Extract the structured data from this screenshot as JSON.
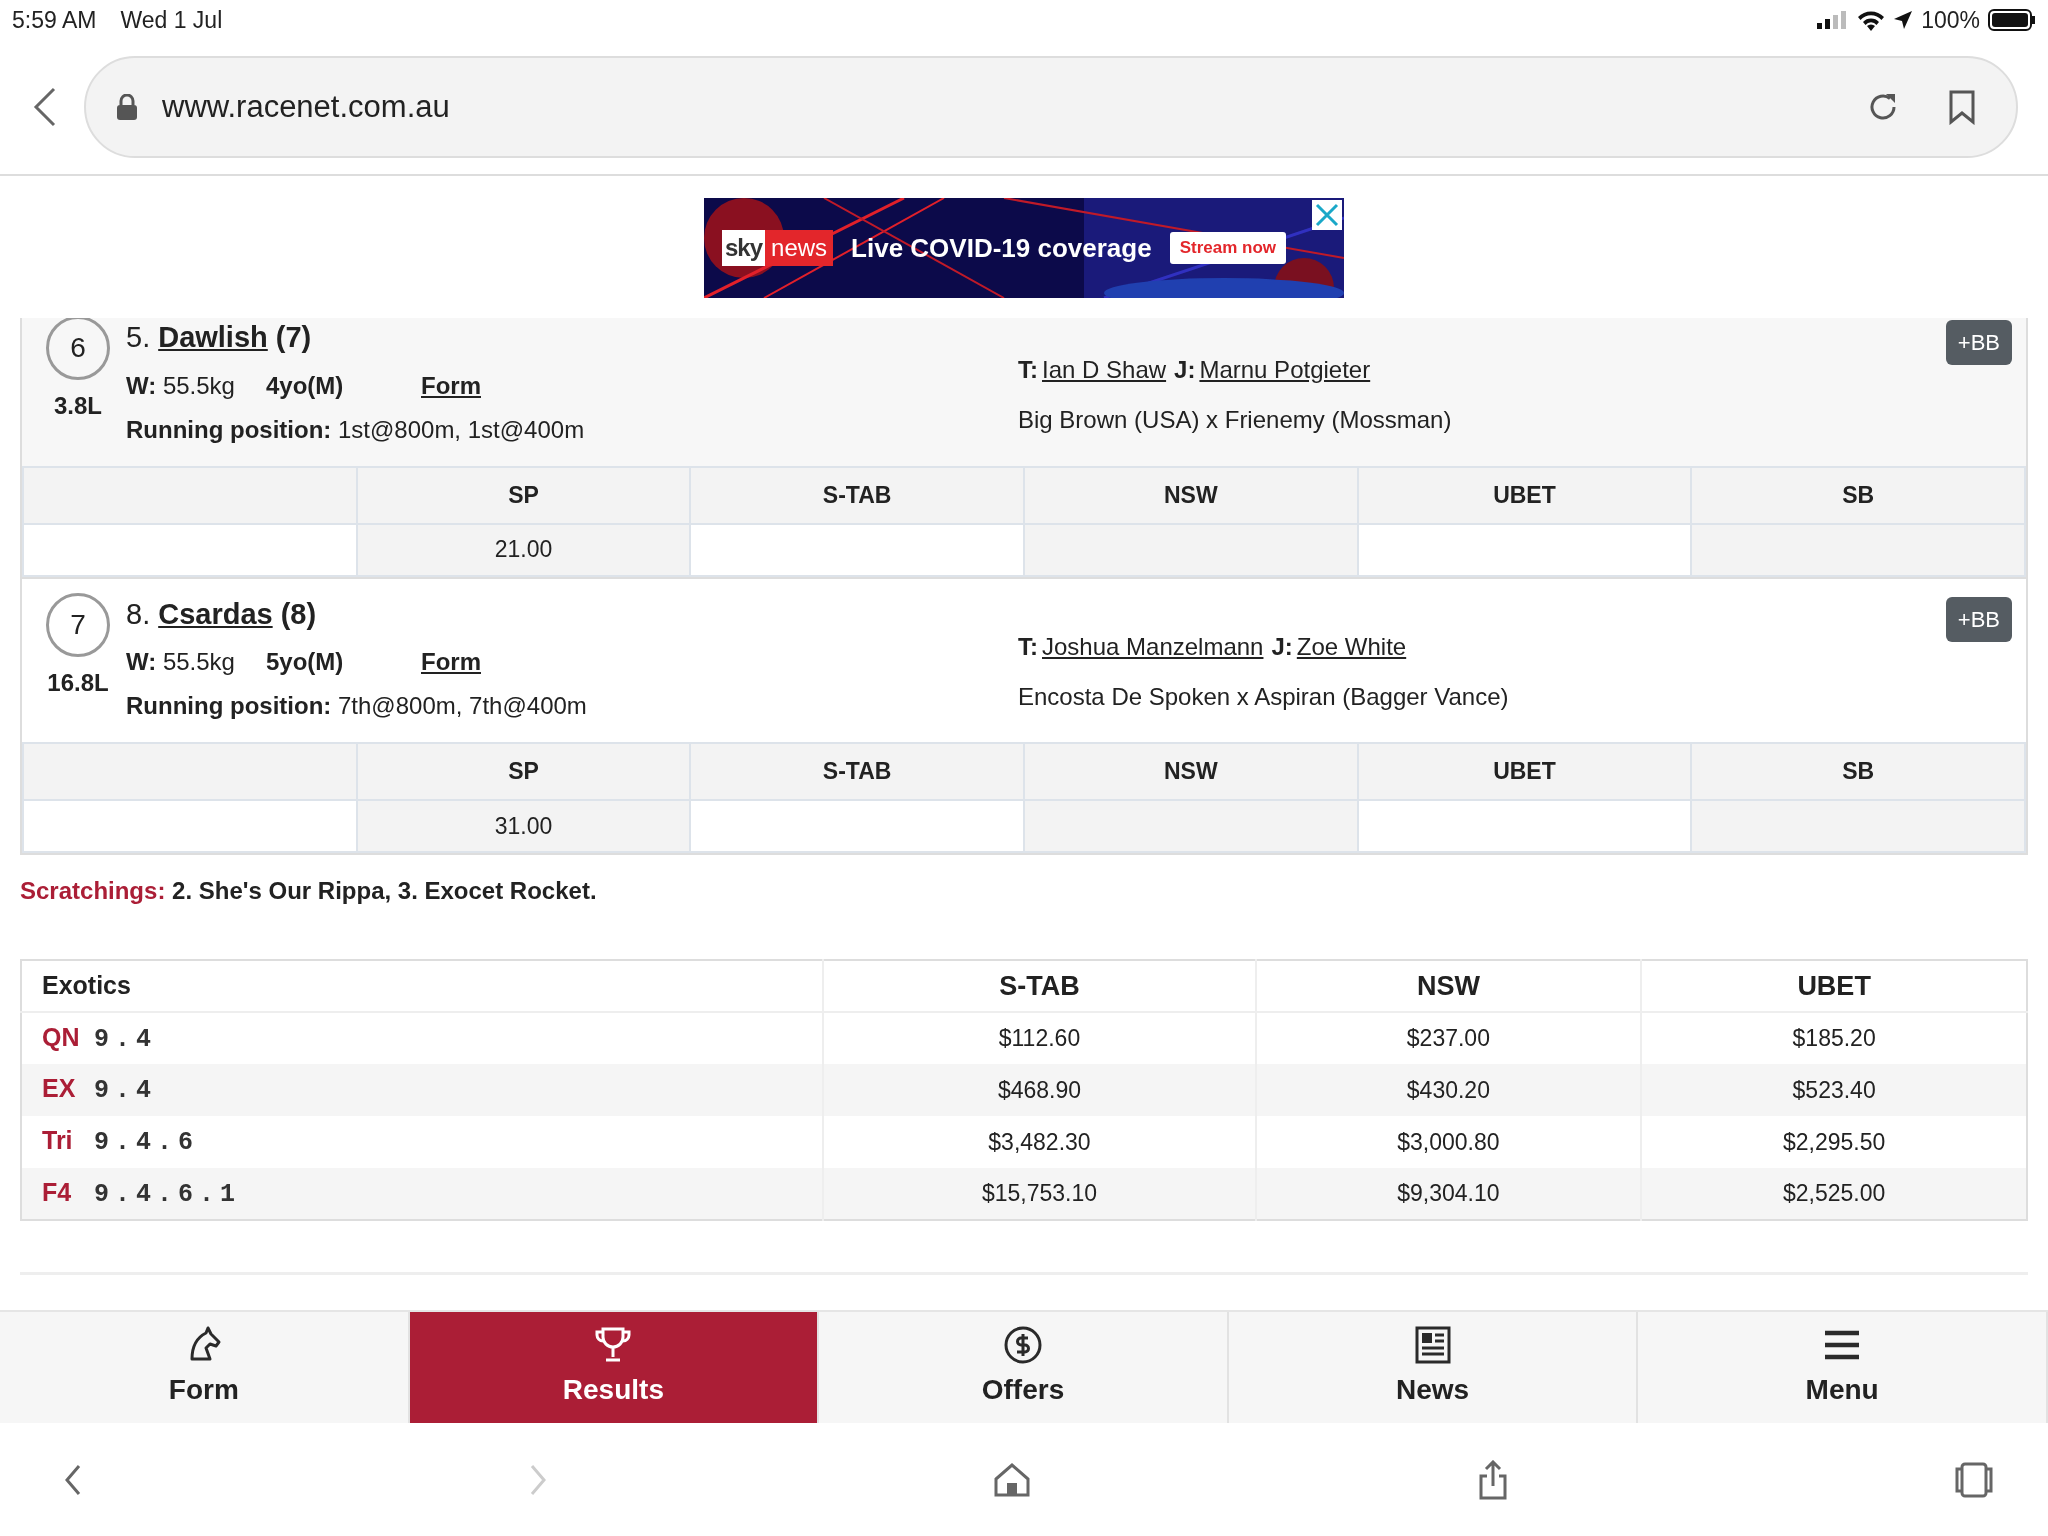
{
  "status_bar": {
    "time": "5:59 AM",
    "date": "Wed 1 Jul",
    "battery": "100%"
  },
  "address_bar": {
    "url": "www.racenet.com.au"
  },
  "ad": {
    "brand_a": "sky",
    "brand_b": "news",
    "headline": "Live COVID-19 coverage",
    "button": "Stream now"
  },
  "runners": [
    {
      "finish": "6",
      "margin": "3.8L",
      "prefix": "5.",
      "name": "Dawlish",
      "barrier": "(7)",
      "weight_label": "W:",
      "weight": "55.5kg",
      "age": "4yo(M)",
      "form_link": "Form",
      "running_label": "Running position:",
      "running": "1st@800m, 1st@400m",
      "trainer_label": "T:",
      "trainer": "Ian D Shaw",
      "jockey_label": "J:",
      "jockey": "Marnu Potgieter",
      "breeding": "Big Brown (USA) x Frienemy (Mossman)",
      "bb": "+BB",
      "odds_columns": [
        "SP",
        "S-TAB",
        "NSW",
        "UBET",
        "SB"
      ],
      "odds": [
        "21.00"
      ]
    },
    {
      "finish": "7",
      "margin": "16.8L",
      "prefix": "8.",
      "name": "Csardas",
      "barrier": "(8)",
      "weight_label": "W:",
      "weight": "55.5kg",
      "age": "5yo(M)",
      "form_link": "Form",
      "running_label": "Running position:",
      "running": "7th@800m, 7th@400m",
      "trainer_label": "T:",
      "trainer": "Joshua Manzelmann",
      "jockey_label": "J:",
      "jockey": "Zoe White",
      "breeding": "Encosta De Spoken x Aspiran (Bagger Vance)",
      "bb": "+BB",
      "odds_columns": [
        "SP",
        "S-TAB",
        "NSW",
        "UBET",
        "SB"
      ],
      "odds": [
        "31.00"
      ]
    }
  ],
  "scratchings": {
    "label": "Scratchings:",
    "text": "2. She's Our Rippa, 3. Exocet Rocket."
  },
  "exotics": {
    "columns": [
      "Exotics",
      "S-TAB",
      "NSW",
      "UBET"
    ],
    "rows": [
      {
        "type": "QN",
        "combo": "9.4",
        "values": [
          "$112.60",
          "$237.00",
          "$185.20"
        ]
      },
      {
        "type": "EX",
        "combo": "9.4",
        "values": [
          "$468.90",
          "$430.20",
          "$523.40"
        ]
      },
      {
        "type": "Tri",
        "combo": "9.4.6",
        "values": [
          "$3,482.30",
          "$3,000.80",
          "$2,295.50"
        ]
      },
      {
        "type": "F4",
        "combo": "9.4.6.1",
        "values": [
          "$15,753.10",
          "$9,304.10",
          "$2,525.00"
        ]
      }
    ]
  },
  "bottom_nav": [
    {
      "label": "Form",
      "selected": false
    },
    {
      "label": "Results",
      "selected": true
    },
    {
      "label": "Offers",
      "selected": false
    },
    {
      "label": "News",
      "selected": false
    },
    {
      "label": "Menu",
      "selected": false
    }
  ],
  "toolbar": [
    {
      "disabled": false
    },
    {
      "disabled": true
    },
    {
      "disabled": false
    },
    {
      "disabled": false
    },
    {
      "disabled": false
    }
  ]
}
